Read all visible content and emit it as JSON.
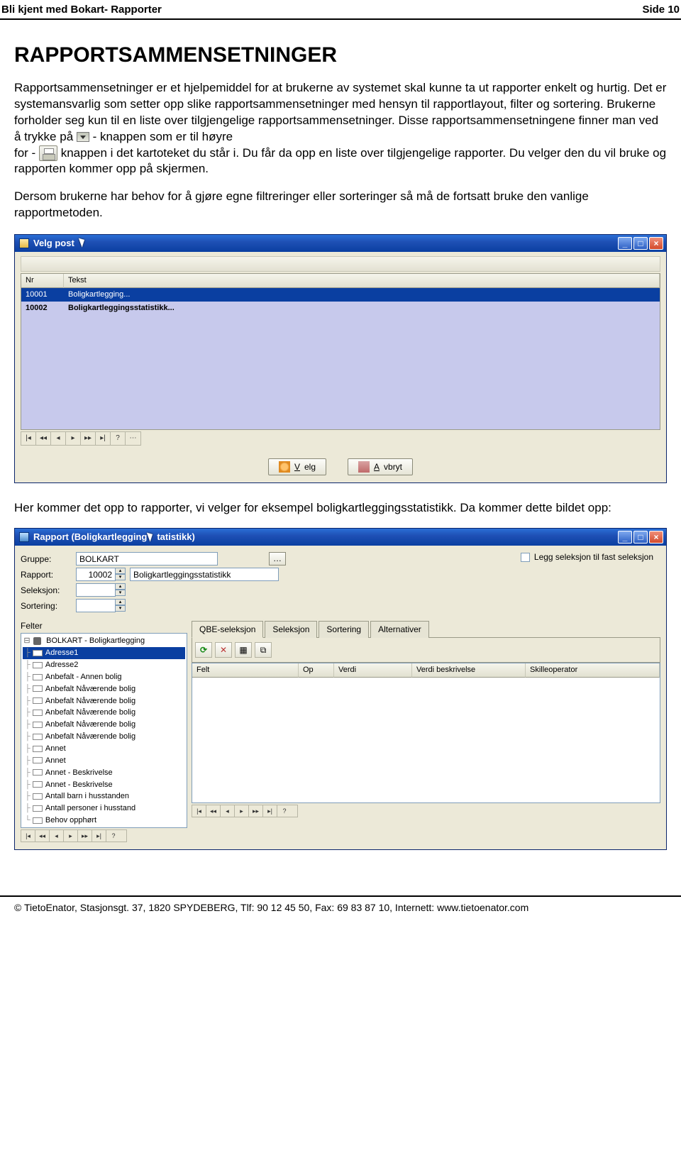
{
  "header": {
    "left": "Bli kjent med Bokart- Rapporter",
    "right": "Side 10"
  },
  "h1": "RAPPORTSAMMENSETNINGER",
  "p1": "Rapportsammensetninger er et hjelpemiddel for at brukerne av systemet skal kunne ta ut rapporter enkelt og hurtig. Det er systemansvarlig som setter opp slike rapportsammensetninger med hensyn til rapportlayout, filter og sortering. Brukerne forholder seg kun til en liste over tilgjengelige rapportsammensetninger. Disse rapportsammensetningene finner man ved å trykke på",
  "p1b": "- knappen som er til høyre",
  "p1c": "for   -",
  "p1d": "knappen i det kartoteket du står i. Du får da opp en liste over tilgjengelige rapporter. Du velger den du vil bruke og rapporten kommer opp på skjermen.",
  "p2": "Dersom brukerne har behov for å gjøre egne filtreringer eller sorteringer så må de fortsatt bruke den vanlige rapportmetoden.",
  "dlg1": {
    "title": "Velg post",
    "col_nr": "Nr",
    "col_tekst": "Tekst",
    "rows": [
      {
        "nr": "10001",
        "tekst": "Boligkartlegging..."
      },
      {
        "nr": "10002",
        "tekst": "Boligkartleggingsstatistikk..."
      }
    ],
    "btn_velg": "Velg",
    "btn_avbryt": "Avbryt"
  },
  "p3": "Her kommer det opp to rapporter, vi velger for eksempel boligkartleggingsstatistikk. Da kommer dette bildet opp:",
  "dlg2": {
    "title": "Rapport (Boligkartlegging",
    "title2": "tatistikk)",
    "lbl_gruppe": "Gruppe:",
    "val_gruppe": "BOLKART",
    "lbl_rapport": "Rapport:",
    "val_rapport_nr": "10002",
    "val_rapport_txt": "Boligkartleggingsstatistikk",
    "lbl_seleksjon": "Seleksjon:",
    "lbl_sortering": "Sortering:",
    "chk_label": "Legg seleksjon til fast seleksjon",
    "felter_label": "Felter",
    "tree_root": "BOLKART - Boligkartlegging",
    "tree_items": [
      "Adresse1",
      "Adresse2",
      "Anbefalt - Annen bolig",
      "Anbefalt Nåværende bolig",
      "Anbefalt Nåværende bolig",
      "Anbefalt Nåværende bolig",
      "Anbefalt Nåværende bolig",
      "Anbefalt Nåværende bolig",
      "Annet",
      "Annet",
      "Annet - Beskrivelse",
      "Annet - Beskrivelse",
      "Antall barn i husstanden",
      "Antall personer i husstand",
      "Behov opphørt"
    ],
    "tabs": [
      "QBE-seleksjon",
      "Seleksjon",
      "Sortering",
      "Alternativer"
    ],
    "grid_cols": [
      "Felt",
      "Op",
      "Verdi",
      "Verdi beskrivelse",
      "Skilleoperator"
    ]
  },
  "footer": "© TietoEnator, Stasjonsgt. 37, 1820 SPYDEBERG, Tlf: 90 12 45 50, Fax: 69 83 87 10, Internett: www.tietoenator.com"
}
